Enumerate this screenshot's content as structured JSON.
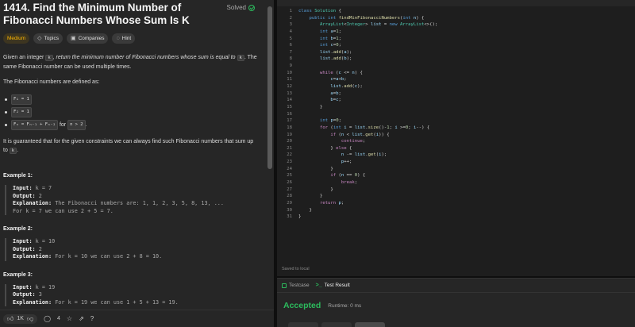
{
  "problem": {
    "title": "1414. Find the Minimum Number of Fibonacci Numbers Whose Sum Is K",
    "status": "Solved",
    "tags": [
      "Medium",
      "Topics",
      "Companies",
      "Hint"
    ],
    "intro_a": "Given an integer",
    "intro_k": "k",
    "intro_b": ", return the minimum number of Fibonacci numbers whose sum is equal to",
    "intro_c": "k",
    "intro_d": ". The same Fibonacci number can be used multiple times.",
    "fib_defined": "The Fibonacci numbers are defined as:",
    "bullets": [
      "F₁ = 1",
      "F₂ = 1",
      "Fₙ = Fₙ₋₁ + Fₙ₋₂"
    ],
    "bullet3_suffix": "for",
    "bullet3_cond": "n > 2",
    "bullet3_end": ".",
    "guarantee": "It is guaranteed that for the given constraints we can always find such Fibonacci numbers that sum up to",
    "guarantee_k": "k",
    "guarantee_end": ".",
    "examples": [
      {
        "heading": "Example 1:",
        "input_label": "Input:",
        "input": "k = 7",
        "output_label": "Output:",
        "output": "2",
        "expl_label": "Explanation:",
        "expl": "The Fibonacci numbers are: 1, 1, 2, 3, 5, 8, 13, ...",
        "expl2": "For k = 7 we can use 2 + 5 = 7."
      },
      {
        "heading": "Example 2:",
        "input_label": "Input:",
        "input": "k = 10",
        "output_label": "Output:",
        "output": "2",
        "expl_label": "Explanation:",
        "expl": "For k = 10 we can use 2 + 8 = 10."
      },
      {
        "heading": "Example 3:",
        "input_label": "Input:",
        "input": "k = 19",
        "output_label": "Output:",
        "output": "3",
        "expl_label": "Explanation:",
        "expl": "For k = 19 we can use 1 + 5 + 13 = 19."
      }
    ]
  },
  "bottom_bar": {
    "likes": "1K",
    "comments": "4"
  },
  "editor": {
    "saved": "Saved to local"
  },
  "result": {
    "tab_testcase": "Testcase",
    "tab_result": "Test Result",
    "status": "Accepted",
    "runtime": "Runtime: 0 ms"
  }
}
